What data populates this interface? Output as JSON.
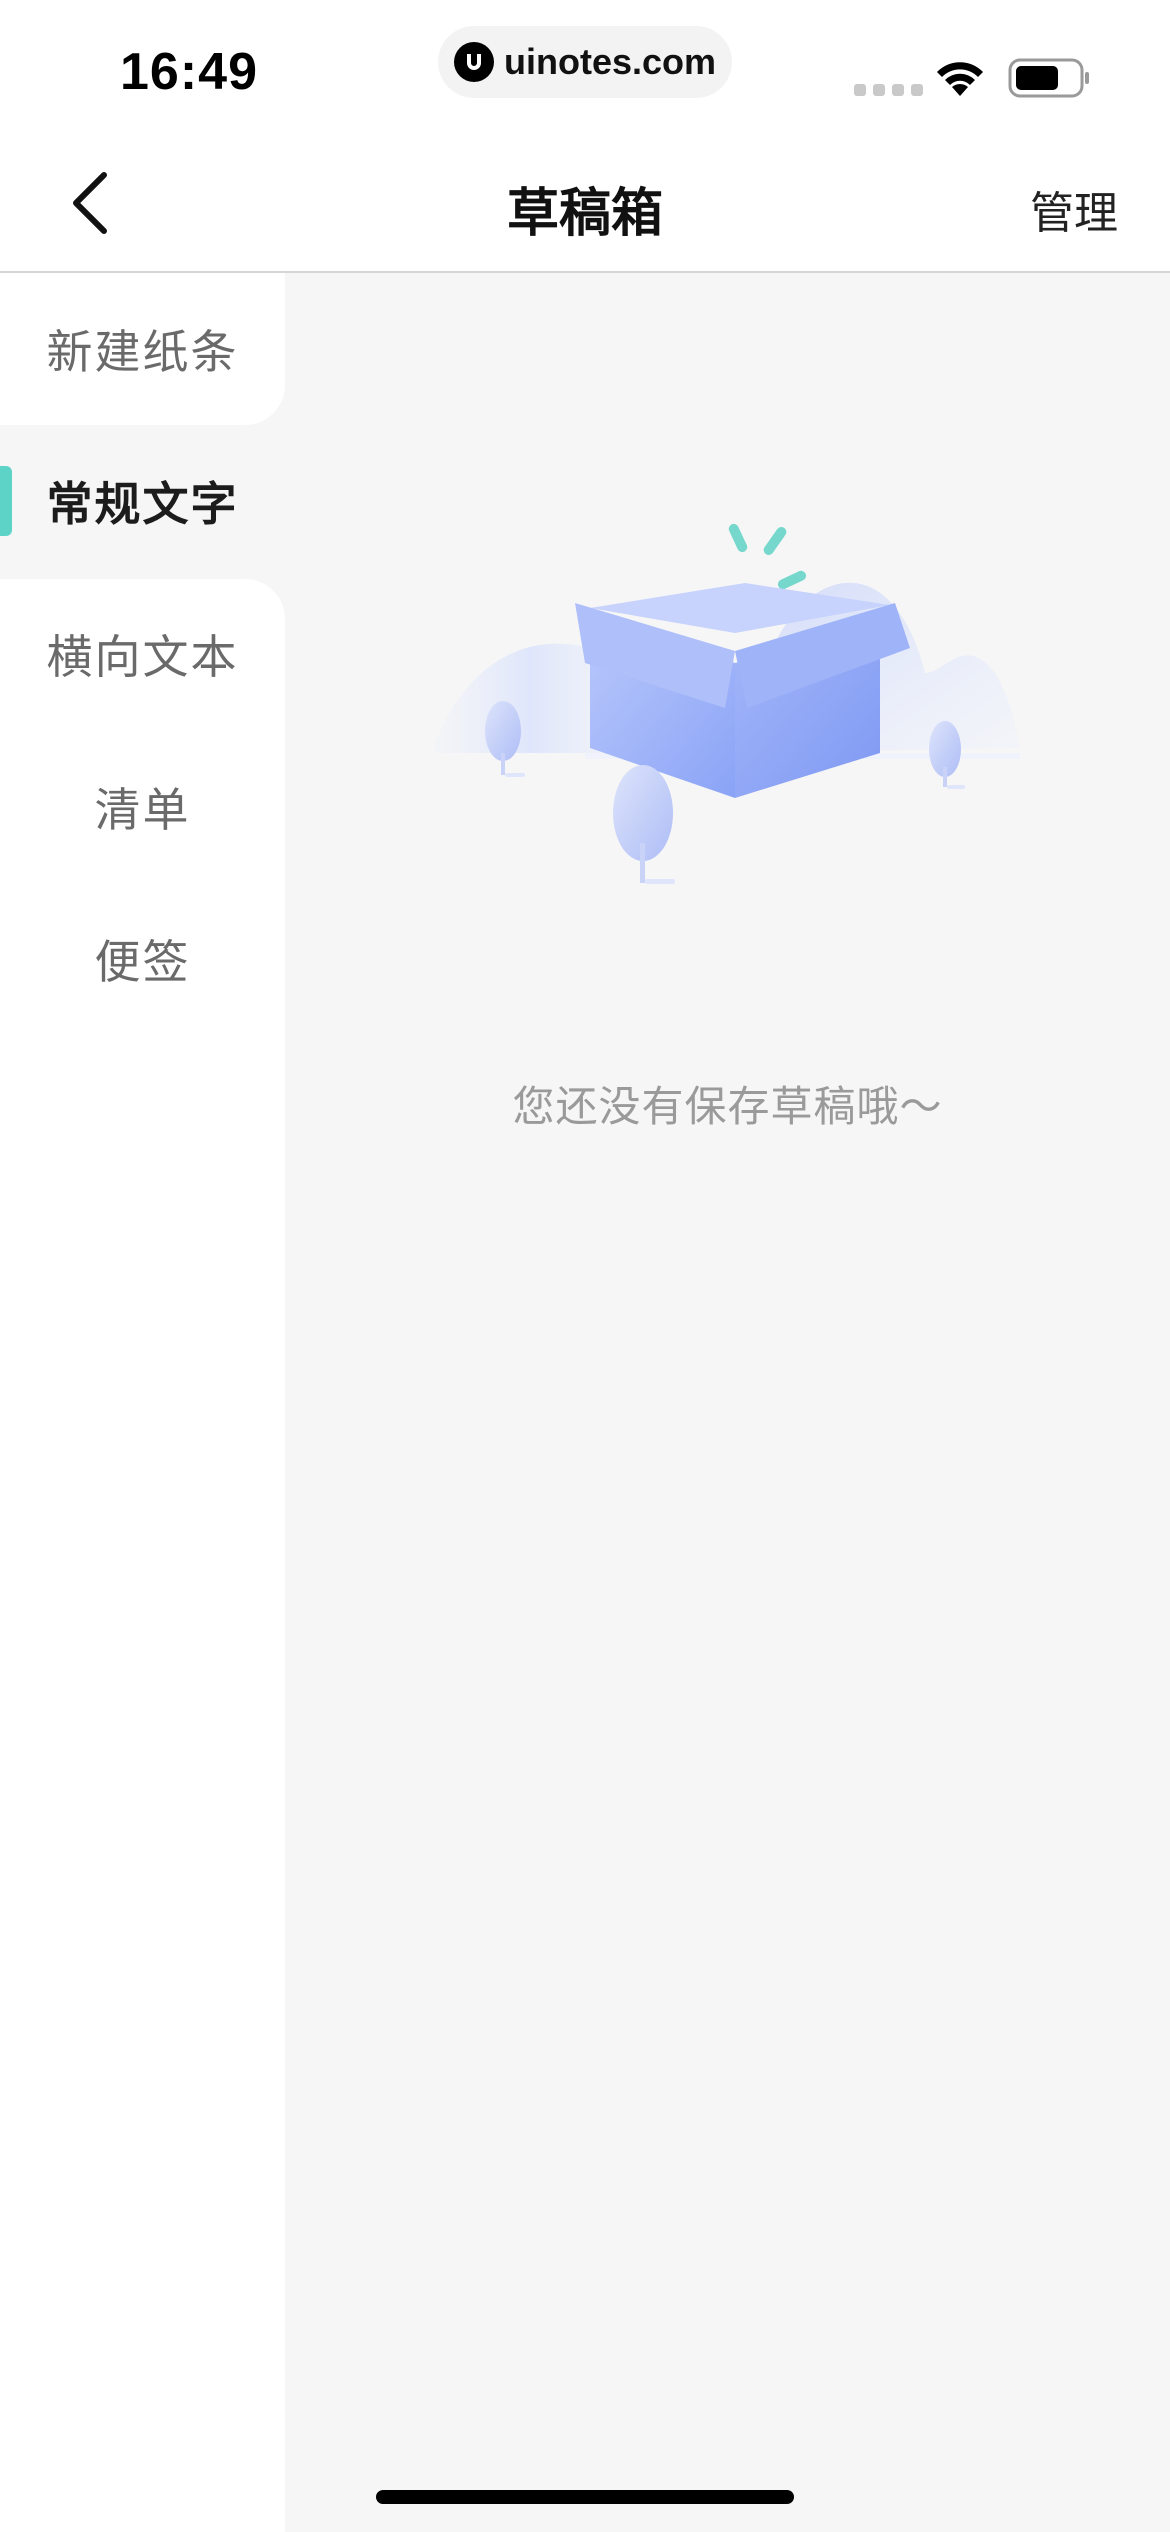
{
  "status_bar": {
    "time": "16:49",
    "url": "uinotes.com"
  },
  "header": {
    "title": "草稿箱",
    "manage_label": "管理"
  },
  "sidebar": {
    "items": [
      {
        "label": "新建纸条",
        "active": false
      },
      {
        "label": "常规文字",
        "active": true
      },
      {
        "label": "横向文本",
        "active": false
      },
      {
        "label": "清单",
        "active": false
      },
      {
        "label": "便签",
        "active": false
      }
    ]
  },
  "main": {
    "empty_message": "您还没有保存草稿哦～"
  },
  "colors": {
    "accent": "#5dd3c8",
    "box": "#8ea6f7",
    "background": "#f6f6f6"
  }
}
